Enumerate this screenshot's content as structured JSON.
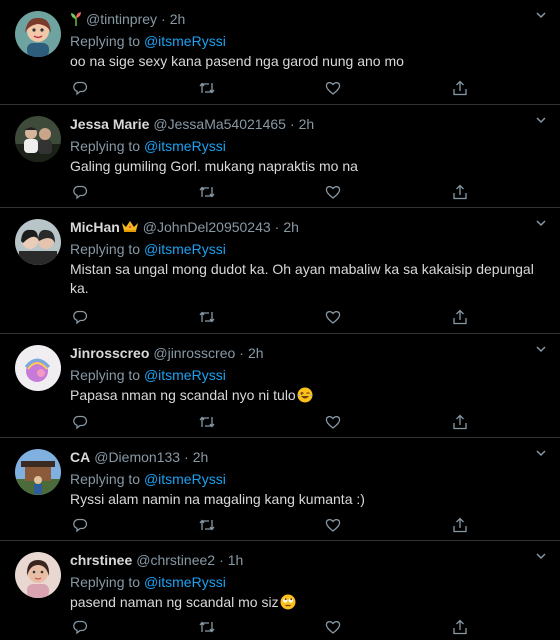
{
  "tweets": [
    {
      "name": "",
      "handle": "@tintinprey",
      "time": "2h",
      "reply_prefix": "Replying to",
      "reply_to": "@itsmeRyssi",
      "text": "oo na sige sexy kana pasend nga garod nung ano mo"
    },
    {
      "name": "Jessa Marie",
      "handle": "@JessaMa54021465",
      "time": "2h",
      "reply_prefix": "Replying to",
      "reply_to": "@itsmeRyssi",
      "text": "Galing gumiling Gorl. mukang napraktis mo na"
    },
    {
      "name": "MicHan",
      "handle": "@JohnDel20950243",
      "time": "2h",
      "reply_prefix": "Replying to",
      "reply_to": "@itsmeRyssi",
      "text": "Mistan sa ungal mong dudot ka. Oh ayan mabaliw ka sa kakaisip depungal ka."
    },
    {
      "name": "Jinrosscreo",
      "handle": "@jinrosscreo",
      "time": "2h",
      "reply_prefix": "Replying to",
      "reply_to": "@itsmeRyssi",
      "text": "Papasa nman ng scandal nyo ni tulo"
    },
    {
      "name": "CA",
      "handle": "@Diemon133",
      "time": "2h",
      "reply_prefix": "Replying to",
      "reply_to": "@itsmeRyssi",
      "text": "Ryssi alam namin na magaling kang kumanta :)"
    },
    {
      "name": "chrstinee",
      "handle": "@chrstinee2",
      "time": "1h",
      "reply_prefix": "Replying to",
      "reply_to": "@itsmeRyssi",
      "text": "pasend naman ng scandal mo siz"
    }
  ],
  "icons": {
    "reply": "reply-icon",
    "retweet": "retweet-icon",
    "like": "like-icon",
    "share": "share-icon",
    "more": "chevron-down-icon"
  },
  "colors": {
    "background": "#000000",
    "text": "#d9d9d9",
    "secondary": "#8899a6",
    "link": "#1da1f2",
    "divider": "#2f3336"
  }
}
